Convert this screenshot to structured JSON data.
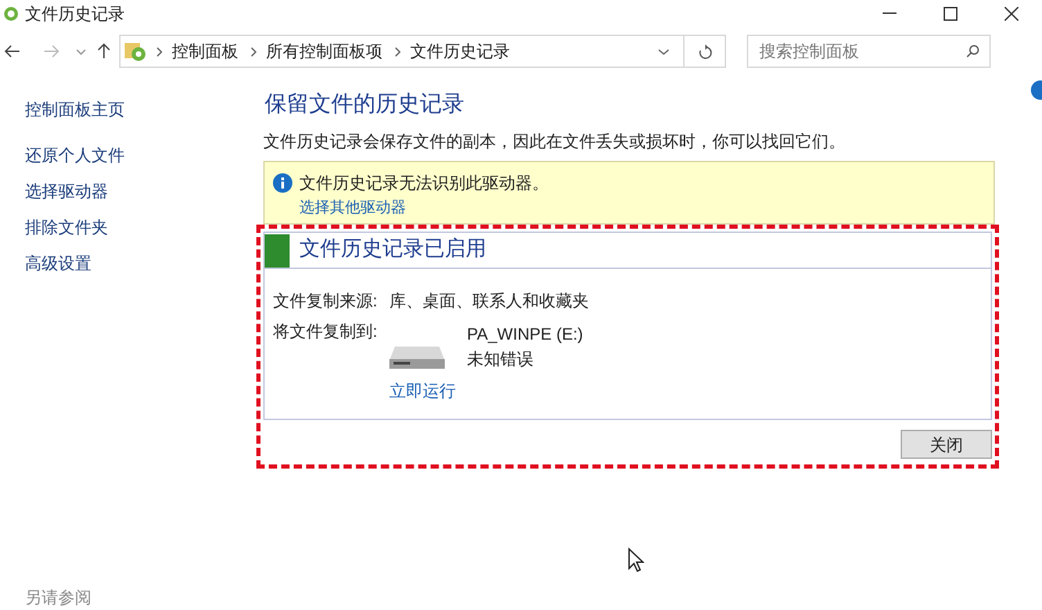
{
  "window": {
    "title": "文件历史记录"
  },
  "address_bar": {
    "crumbs": [
      "控制面板",
      "所有控制面板项",
      "文件历史记录"
    ]
  },
  "search": {
    "placeholder": "搜索控制面板"
  },
  "sidebar": {
    "home": "控制面板主页",
    "items": [
      "还原个人文件",
      "选择驱动器",
      "排除文件夹",
      "高级设置"
    ],
    "see_also": "另请参阅"
  },
  "main": {
    "heading": "保留文件的历史记录",
    "description": "文件历史记录会保存文件的副本，因此在文件丢失或损坏时，你可以找回它们。",
    "notice": {
      "message": "文件历史记录无法识别此驱动器。",
      "link": "选择其他驱动器"
    },
    "status": {
      "title": "文件历史记录已启用",
      "on": true,
      "source_label": "文件复制来源:",
      "source_value": "库、桌面、联系人和收藏夹",
      "target_label": "将文件复制到:",
      "drive_name": "PA_WINPE (E:)",
      "drive_status": "未知错误",
      "run_link": "立即运行"
    },
    "close_button": "关闭"
  }
}
